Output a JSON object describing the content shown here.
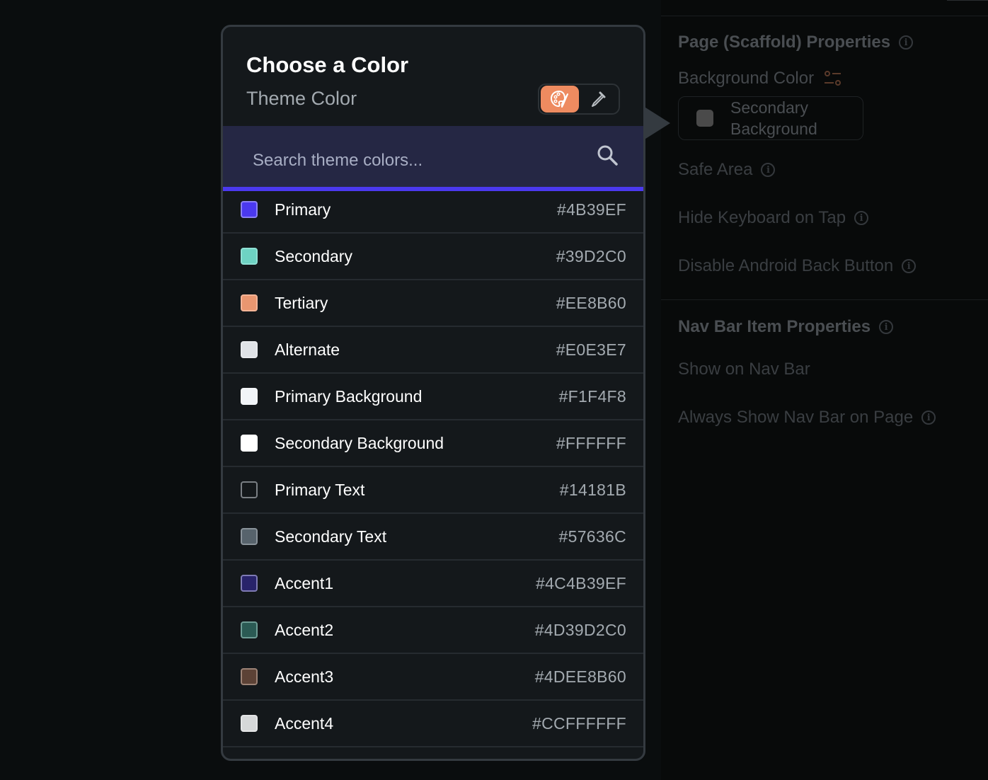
{
  "picker": {
    "title": "Choose a Color",
    "subtitle": "Theme Color",
    "mode_toggle": [
      {
        "icon": "palette-icon",
        "active": true
      },
      {
        "icon": "eyedropper-icon",
        "active": false
      }
    ],
    "search": {
      "value": "",
      "placeholder": "Search theme colors..."
    },
    "colors": [
      {
        "name": "Primary",
        "hex": "#4B39EF",
        "swatch": "#4B39EF",
        "border": "#8b80f5"
      },
      {
        "name": "Secondary",
        "hex": "#39D2C0",
        "swatch": "#6ed3c3",
        "border": "#8fe0d4"
      },
      {
        "name": "Tertiary",
        "hex": "#EE8B60",
        "swatch": "#e99670",
        "border": "#f3b497"
      },
      {
        "name": "Alternate",
        "hex": "#E0E3E7",
        "swatch": "#e0e3e7",
        "border": "#e8eaed"
      },
      {
        "name": "Primary Background",
        "hex": "#F1F4F8",
        "swatch": "#f1f4f8",
        "border": "#f4f6f9"
      },
      {
        "name": "Secondary Background",
        "hex": "#FFFFFF",
        "swatch": "#ffffff",
        "border": "#ffffff"
      },
      {
        "name": "Primary Text",
        "hex": "#14181B",
        "swatch": "#14181b",
        "border": "#7a7f84"
      },
      {
        "name": "Secondary Text",
        "hex": "#57636C",
        "swatch": "#57636c",
        "border": "#8a939a"
      },
      {
        "name": "Accent1",
        "hex": "#4C4B39EF",
        "swatch": "#28236a",
        "border": "#7f7bb4"
      },
      {
        "name": "Accent2",
        "hex": "#4D39D2C0",
        "swatch": "#2b5a54",
        "border": "#6e9c95"
      },
      {
        "name": "Accent3",
        "hex": "#4DEE8B60",
        "swatch": "#5c4236",
        "border": "#9c8376"
      },
      {
        "name": "Accent4",
        "hex": "#CCFFFFFF",
        "swatch": "#d6d8d9",
        "border": "#e4e5e6"
      }
    ]
  },
  "properties": {
    "page_section": {
      "title": "Page (Scaffold) Properties",
      "background_color_label": "Background Color",
      "background_color_value_line1": "Secondary",
      "background_color_value_line2": "Background",
      "background_color_swatch": "#4a4a4a",
      "safe_area": "Safe Area",
      "hide_keyboard": "Hide Keyboard on Tap",
      "disable_back": "Disable Android Back Button"
    },
    "nav_section": {
      "title": "Nav Bar Item Properties",
      "show_on_nav": "Show on Nav Bar",
      "always_show": "Always Show Nav Bar on Page"
    }
  },
  "colors": {
    "accent": "#4B39EF",
    "tertiary": "#EE8B60",
    "search_bg": "#252744"
  }
}
